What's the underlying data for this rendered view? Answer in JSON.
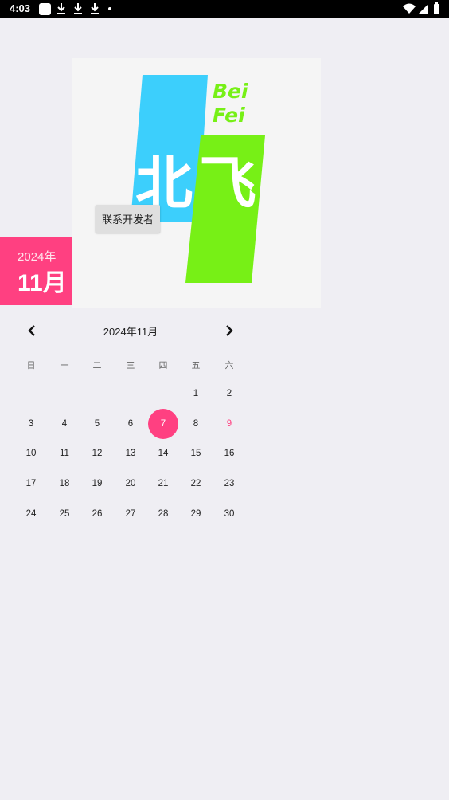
{
  "status_bar": {
    "time": "4:03"
  },
  "banner": {
    "logo_text_en_line1": "Bei",
    "logo_text_en_line2": "Fei",
    "logo_char_left": "北",
    "logo_char_right": "飞",
    "logo_colors": {
      "blue": "#3ccffc",
      "green": "#77f016"
    }
  },
  "contact_button": {
    "label": "联系开发者"
  },
  "date_card": {
    "year": "2024年",
    "month": "11月",
    "color": "#ff4081"
  },
  "calendar": {
    "title": "2024年11月",
    "weekdays": [
      "日",
      "一",
      "二",
      "三",
      "四",
      "五",
      "六"
    ],
    "weeks": [
      [
        "",
        "",
        "",
        "",
        "",
        "1",
        "2"
      ],
      [
        "3",
        "4",
        "5",
        "6",
        "7",
        "8",
        "9"
      ],
      [
        "10",
        "11",
        "12",
        "13",
        "14",
        "15",
        "16"
      ],
      [
        "17",
        "18",
        "19",
        "20",
        "21",
        "22",
        "23"
      ],
      [
        "24",
        "25",
        "26",
        "27",
        "28",
        "29",
        "30"
      ]
    ],
    "selected_day": "7",
    "highlighted_days": [
      "9"
    ],
    "accent_color": "#ff4081"
  }
}
